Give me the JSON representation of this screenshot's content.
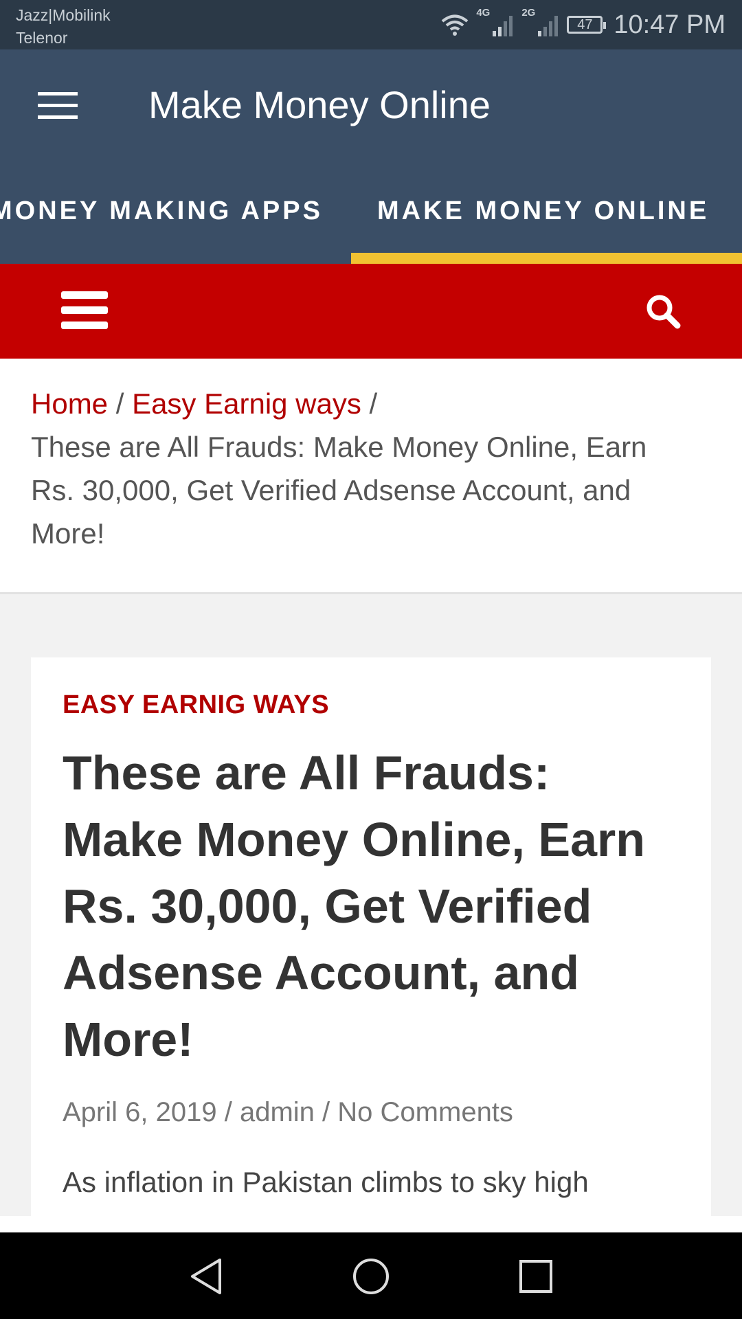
{
  "status_bar": {
    "carrier_line1": "Jazz|Mobilink",
    "carrier_line2": "Telenor",
    "signal1_label": "4G",
    "signal2_label": "2G",
    "battery_level": "47",
    "time": "10:47 PM",
    "icons": [
      "wifi-icon",
      "signal-icon",
      "signal-icon",
      "battery-icon"
    ]
  },
  "header": {
    "site_title": "Make Money Online",
    "nav": [
      {
        "label": "MONEY MAKING APPS",
        "active": false
      },
      {
        "label": "MAKE MONEY ONLINE",
        "active": true
      }
    ],
    "accent_color": "#f1c232",
    "background": "#3a4e66"
  },
  "toolbar": {
    "background": "#c40000",
    "menu_icon": "menu-icon",
    "search_icon": "search-icon"
  },
  "breadcrumb": {
    "home": "Home",
    "category": "Easy Earnig ways",
    "separator": "/",
    "current": "These are All Frauds: Make Money Online, Earn Rs. 30,000, Get Verified Adsense Account, and More!"
  },
  "article": {
    "category": "EASY EARNIG WAYS",
    "title": "These are All Frauds: Make Money Online, Earn Rs. 30,000, Get Verified Adsense Account, and More!",
    "date": "April 6, 2019",
    "author": "admin",
    "comments": "No Comments",
    "meta_separator": "/",
    "excerpt": "As inflation in Pakistan climbs to sky high"
  },
  "system_nav": {
    "buttons": [
      "back-icon",
      "home-icon",
      "recents-icon"
    ]
  }
}
